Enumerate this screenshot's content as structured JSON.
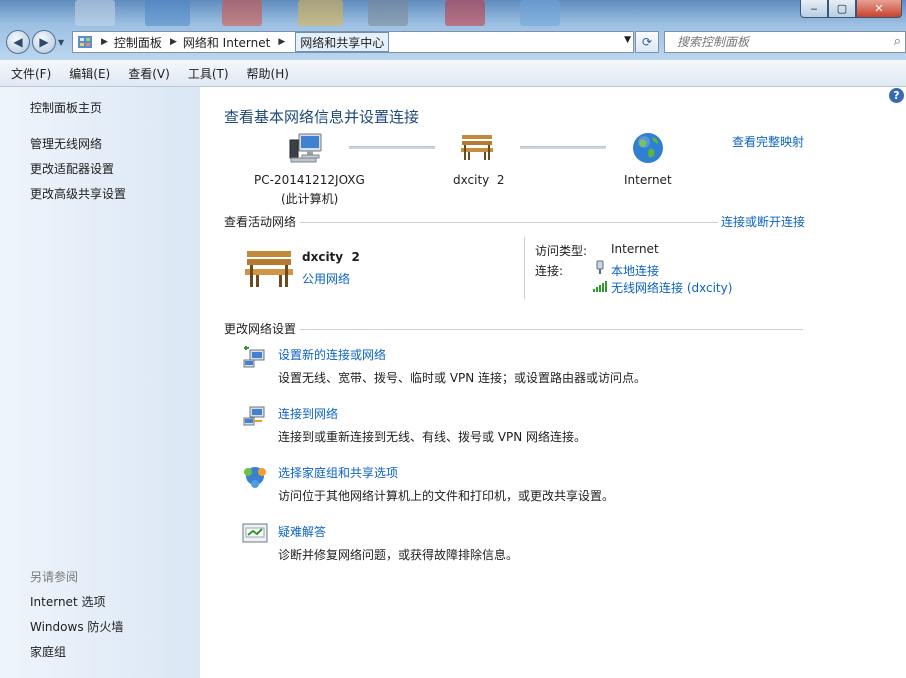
{
  "address_bar": {
    "crumbs": [
      "控制面板",
      "网络和 Internet",
      "网络和共享中心"
    ]
  },
  "search": {
    "placeholder": "搜索控制面板"
  },
  "menu": [
    "文件(F)",
    "编辑(E)",
    "查看(V)",
    "工具(T)",
    "帮助(H)"
  ],
  "sidebar": {
    "home": "控制面板主页",
    "tasks": [
      "管理无线网络",
      "更改适配器设置",
      "更改高级共享设置"
    ],
    "see_also_title": "另请参阅",
    "see_also": [
      "Internet 选项",
      "Windows 防火墙",
      "家庭组"
    ]
  },
  "main": {
    "title": "查看基本网络信息并设置连接",
    "full_map_link": "查看完整映射",
    "map": {
      "computer_name": "PC-20141212JOXG",
      "computer_sub": "(此计算机)",
      "network_name": "dxcity  2",
      "internet": "Internet"
    },
    "active_section": {
      "title": "查看活动网络",
      "toggle_link": "连接或断开连接",
      "network_name": "dxcity  2",
      "network_type": "公用网络",
      "access_type_label": "访问类型:",
      "access_type_value": "Internet",
      "connections_label": "连接:",
      "connection_local": "本地连接",
      "connection_wireless": "无线网络连接 (dxcity)"
    },
    "change_section": {
      "title": "更改网络设置",
      "items": [
        {
          "link": "设置新的连接或网络",
          "desc": "设置无线、宽带、拨号、临时或 VPN 连接；或设置路由器或访问点。",
          "icon": "new-connection-icon"
        },
        {
          "link": "连接到网络",
          "desc": "连接到或重新连接到无线、有线、拨号或 VPN 网络连接。",
          "icon": "connect-network-icon"
        },
        {
          "link": "选择家庭组和共享选项",
          "desc": "访问位于其他网络计算机上的文件和打印机，或更改共享设置。",
          "icon": "homegroup-icon"
        },
        {
          "link": "疑难解答",
          "desc": "诊断并修复网络问题，或获得故障排除信息。",
          "icon": "troubleshoot-icon"
        }
      ]
    }
  }
}
